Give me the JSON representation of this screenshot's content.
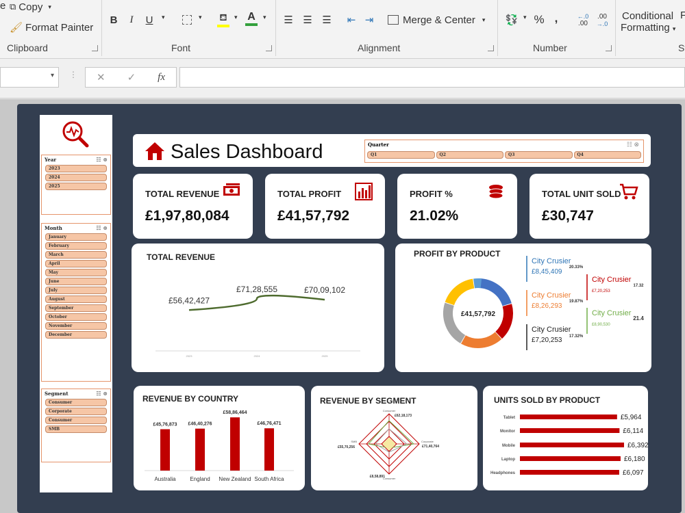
{
  "ribbon": {
    "clipboard": {
      "copy_label": "Copy",
      "format_painter_label": "Format Painter",
      "group_label": "Clipboard"
    },
    "font": {
      "bold": "B",
      "italic": "I",
      "underline": "U",
      "font_color_letter": "A",
      "group_label": "Font"
    },
    "alignment": {
      "merge_center_label": "Merge & Center",
      "group_label": "Alignment"
    },
    "number": {
      "percent": "%",
      "comma": ",",
      "inc_decimal": ".00",
      "dec_decimal": ".0",
      "group_label": "Number"
    },
    "styles": {
      "conditional_formatting_line1": "Conditional",
      "conditional_formatting_line2": "Formatting",
      "group_label_partial": "St",
      "format_partial": "F"
    },
    "tab_partial": "e"
  },
  "formula_bar": {
    "cancel_symbol": "✕",
    "enter_symbol": "✓",
    "fx_label": "fx",
    "content": ""
  },
  "dashboard": {
    "title": "Sales Dashboard",
    "slicers": {
      "quarter": {
        "header": "Quarter",
        "items": [
          "Q1",
          "Q2",
          "Q3",
          "Q4"
        ]
      },
      "year": {
        "header": "Year",
        "items": [
          "2023",
          "2024",
          "2025"
        ]
      },
      "month": {
        "header": "Month",
        "items": [
          "January",
          "February",
          "March",
          "April",
          "May",
          "June",
          "July",
          "August",
          "September",
          "October",
          "November",
          "December"
        ]
      },
      "segment": {
        "header": "Segment",
        "items": [
          "Consumer",
          "Corporate",
          "Consumer",
          "SMB"
        ]
      }
    },
    "kpis": [
      {
        "title": "TOTAL REVENUE",
        "value": "£1,97,80,084",
        "icon": "cash-icon"
      },
      {
        "title": "TOTAL PROFIT",
        "value": "£41,57,792",
        "icon": "bar-chart-icon"
      },
      {
        "title": "PROFIT %",
        "value": "21.02%",
        "icon": "coins-icon"
      },
      {
        "title": "TOTAL UNIT SOLD",
        "value": "£30,747",
        "icon": "cart-icon"
      }
    ],
    "accent_color": "#c00000"
  },
  "chart_data": [
    {
      "type": "line",
      "title": "TOTAL REVENUE",
      "x": [
        "2023",
        "2024",
        "2025"
      ],
      "values": [
        5642427,
        7128555,
        7009102
      ],
      "data_labels": [
        "£56,42,427",
        "£71,28,555",
        "£70,09,102"
      ],
      "color": "#4e6b2e"
    },
    {
      "type": "pie",
      "title": "PROFIT BY PRODUCT",
      "center_label": "£41,57,792",
      "slices": [
        {
          "value": 20.33,
          "color": "#4472c4"
        },
        {
          "value": 17.32,
          "color": "#c00000"
        },
        {
          "value": 19.87,
          "color": "#ed7d31"
        },
        {
          "value": 21.4,
          "color": "#a5a5a5"
        },
        {
          "value": 17.32,
          "color": "#ffc000"
        },
        {
          "value": 3.76,
          "color": "#5b9bd5"
        }
      ],
      "callouts": [
        {
          "name": "City Crusier",
          "value": "£8,45,409",
          "pct": "20.33%",
          "color": "#2e75b6"
        },
        {
          "name": "City Crusier",
          "value": "£7,20,253",
          "pct": "17.32",
          "color": "#c00000"
        },
        {
          "name": "City Crusier",
          "value": "£8,26,293",
          "pct": "19.87%",
          "color": "#ed7d31"
        },
        {
          "name": "City Crusier",
          "value": "£8,90,530",
          "pct": "21.4",
          "color": "#70ad47"
        },
        {
          "name": "City Crusier",
          "value": "£7,20,253",
          "pct": "17.32%",
          "color": "#222222"
        }
      ]
    },
    {
      "type": "bar",
      "title": "REVENUE BY COUNTRY",
      "categories": [
        "Australia",
        "England",
        "New Zealand",
        "South Africa"
      ],
      "values": [
        4576873,
        4640276,
        5886464,
        4676471
      ],
      "data_labels": [
        "£45,76,873",
        "£46,40,276",
        "£58,86,464",
        "£46,76,471"
      ],
      "color": "#c00000"
    },
    {
      "type": "radar",
      "title": "REVENUE BY SEGMENT",
      "categories": [
        "Consumer",
        "Corporate",
        "Consumer",
        "SMB"
      ],
      "data_labels": [
        "£62,18,173",
        "£71,40,764",
        "£8,58,891",
        "£55,70,256"
      ]
    },
    {
      "type": "bar",
      "title": "UNITS SOLD BY PRODUCT",
      "categories": [
        "Tablet",
        "Monitor",
        "Mobile",
        "Laptop",
        "Headphones"
      ],
      "values": [
        5964,
        6114,
        6392,
        6180,
        6097
      ],
      "data_labels": [
        "£5,964",
        "£6,114",
        "£6,392",
        "£6,180",
        "£6,097"
      ],
      "color": "#c00000"
    }
  ]
}
